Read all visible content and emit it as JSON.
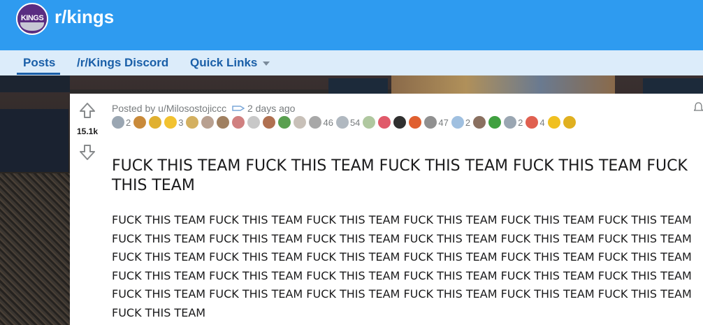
{
  "subreddit": {
    "name": "r/kings",
    "logo_text": "KINGS"
  },
  "nav": {
    "items": [
      {
        "label": "Posts",
        "active": true
      },
      {
        "label": "/r/Kings Discord",
        "active": false
      },
      {
        "label": "Quick Links",
        "active": false,
        "dropdown": true
      }
    ]
  },
  "post": {
    "score": "15.1k",
    "posted_by": "Posted by u/Milosostojiccc",
    "time": "2 days ago",
    "title": "FUCK THIS TEAM FUCK THIS TEAM FUCK THIS TEAM FUCK THIS TEAM FUCK THIS TEAM",
    "body": "FUCK THIS TEAM FUCK THIS TEAM FUCK THIS TEAM FUCK THIS TEAM FUCK THIS TEAM FUCK THIS TEAM FUCK THIS TEAM FUCK THIS TEAM FUCK THIS TEAM FUCK THIS TEAM FUCK THIS TEAM FUCK THIS TEAM FUCK THIS TEAM FUCK THIS TEAM FUCK THIS TEAM FUCK THIS TEAM FUCK THIS TEAM FUCK THIS TEAM FUCK THIS TEAM FUCK THIS TEAM FUCK THIS TEAM FUCK THIS TEAM FUCK THIS TEAM FUCK THIS TEAM FUCK THIS TEAM FUCK THIS TEAM FUCK THIS TEAM FUCK THIS TEAM FUCK THIS TEAM FUCK THIS TEAM FUCK THIS TEAM",
    "awards": [
      {
        "icon": "silver-award-icon",
        "color": "#9aa6b2",
        "count": "2"
      },
      {
        "icon": "hand-award-icon",
        "color": "#c98a3a",
        "count": ""
      },
      {
        "icon": "hands-award-icon",
        "color": "#e0b030",
        "count": ""
      },
      {
        "icon": "gold-star-award-icon",
        "color": "#f2c230",
        "count": "3"
      },
      {
        "icon": "flower-award-icon",
        "color": "#d4b060",
        "count": ""
      },
      {
        "icon": "mask-award-icon",
        "color": "#b8a090",
        "count": ""
      },
      {
        "icon": "cat-award-icon",
        "color": "#a08060",
        "count": ""
      },
      {
        "icon": "face-award-icon",
        "color": "#d08080",
        "count": ""
      },
      {
        "icon": "skull-award-icon",
        "color": "#c8c8c8",
        "count": ""
      },
      {
        "icon": "pet-award-icon",
        "color": "#b07050",
        "count": ""
      },
      {
        "icon": "snake-award-icon",
        "color": "#5aa050",
        "count": ""
      },
      {
        "icon": "f-award-icon",
        "color": "#c8c0b8",
        "count": ""
      },
      {
        "icon": "glasses-award-icon",
        "color": "#a8a8a8",
        "count": "46"
      },
      {
        "icon": "cloud-award-icon",
        "color": "#b0b8c0",
        "count": "54"
      },
      {
        "icon": "angel-award-icon",
        "color": "#b0c8a0",
        "count": ""
      },
      {
        "icon": "heart-award-icon",
        "color": "#e05a6a",
        "count": ""
      },
      {
        "icon": "panda-award-icon",
        "color": "#303030",
        "count": ""
      },
      {
        "icon": "fire-award-icon",
        "color": "#e06030",
        "count": ""
      },
      {
        "icon": "s-award-icon",
        "color": "#909090",
        "count": "47"
      },
      {
        "icon": "baby-award-icon",
        "color": "#a0c0e0",
        "count": "2"
      },
      {
        "icon": "bear-award-icon",
        "color": "#8a7060",
        "count": ""
      },
      {
        "icon": "dino-award-icon",
        "color": "#40a040",
        "count": ""
      },
      {
        "icon": "rocket-award-icon",
        "color": "#9aa6b2",
        "count": "2"
      },
      {
        "icon": "snoo-award-icon",
        "color": "#e06050",
        "count": "4"
      },
      {
        "icon": "up-arrow-award-icon",
        "color": "#f0c020",
        "count": ""
      },
      {
        "icon": "sun-award-icon",
        "color": "#e0b020",
        "count": ""
      }
    ]
  }
}
